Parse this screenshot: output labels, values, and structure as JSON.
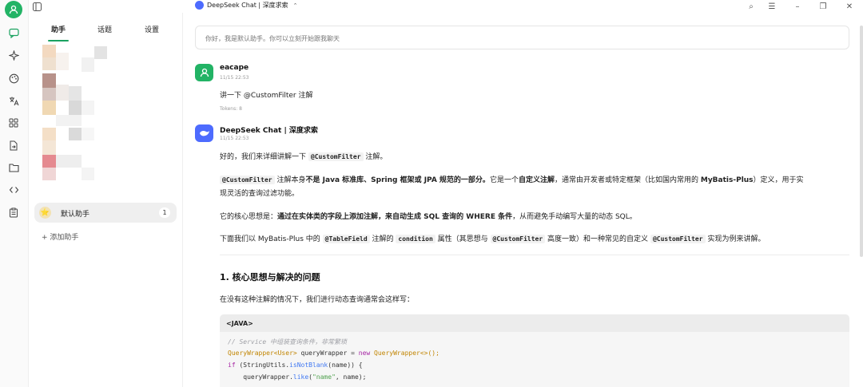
{
  "window": {
    "title": "DeepSeek Chat | 深度求索",
    "title_chevron": "⌃",
    "controls": {
      "search": "⌕",
      "layout": "☰",
      "minimize": "–",
      "restore": "❐",
      "close": "✕"
    }
  },
  "sidebar": {
    "tabs": [
      "助手",
      "话题",
      "设置"
    ],
    "active_tab": "助手",
    "assistant": {
      "name": "默认助手",
      "count": "1",
      "icon": "⭐"
    },
    "add_label": "+ 添加助手"
  },
  "prompt": {
    "placeholder": "你好，我是默认助手。你可以立刻开始跟我聊天"
  },
  "messages": {
    "user": {
      "name": "eacape",
      "time": "11/15 22:53",
      "text": "讲一下 @CustomFilter 注解",
      "tokens": "Tokens: 8"
    },
    "assistant": {
      "name": "DeepSeek Chat | 深度求索",
      "time": "11/15 22:53",
      "p1a": "好的，我们来详细讲解一下",
      "p1code": "@CustomFilter",
      "p1b": "注解。",
      "p2code": "@CustomFilter",
      "p2a": "注解本身",
      "p2b": "不是 Java 标准库、Spring 框架或 JPA 规范的一部分。",
      "p2c": "它是一个",
      "p2d": "自定义注解",
      "p2e": "，通常由开发者或特定框架（比如国内常用的",
      "p2f": "MyBatis-Plus",
      "p2g": "）定义，用于实",
      "p2h": "现灵活的查询过滤功能。",
      "p3a": "它的核心思想是：",
      "p3b": "通过在实体类的字段上添加注解，来自动生成 SQL 查询的 WHERE 条件",
      "p3c": "，从而避免手动编写大量的动态 SQL。",
      "p4a": "下面我们以 MyBatis-Plus 中的",
      "p4code1": "@TableField",
      "p4b": "注解的",
      "p4code2": "condition",
      "p4c": "属性（其思想与",
      "p4code3": "@CustomFilter",
      "p4d": "高度一致）和一种常见的自定义",
      "p4code4": "@CustomFilter",
      "p4e": "实现为例来讲解。",
      "h1": "1. 核心思想与解决的问题",
      "p5": "在没有这种注解的情况下，我们进行动态查询通常会这样写：",
      "code_lang": "<JAVA>",
      "code": {
        "l1": "// Service 中组装查询条件，非常繁琐",
        "l2a": "QueryWrapper<User>",
        "l2b": " queryWrapper = ",
        "l2c": "new",
        "l2d": " QueryWrapper<>();",
        "l3a": "if",
        "l3b": " (StringUtils.",
        "l3c": "isNotBlank",
        "l3d": "(name)) {",
        "l4a": "    queryWrapper.",
        "l4b": "like",
        "l4c": "(",
        "l4d": "\"name\"",
        "l4e": ", name);"
      }
    }
  },
  "colors": {
    "accent": "#1aa260",
    "user_avatar": "#22b365",
    "bot_avatar": "#4d6bfe"
  }
}
